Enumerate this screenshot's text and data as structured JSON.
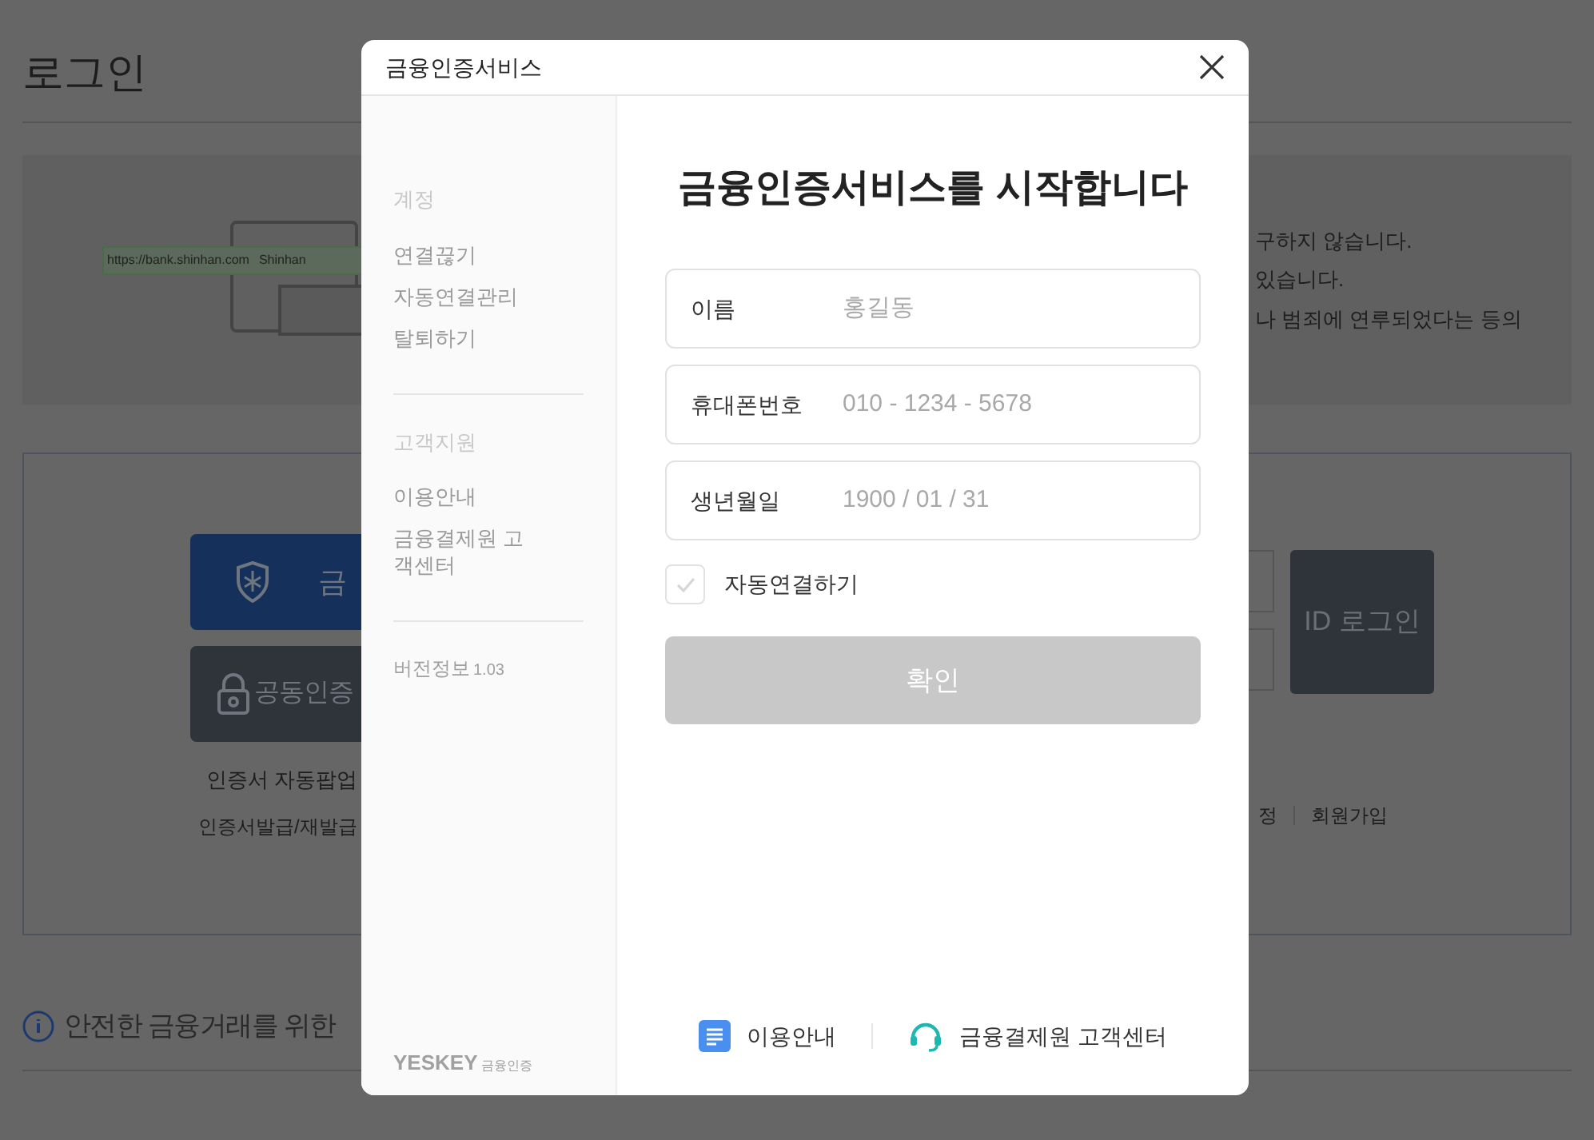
{
  "page": {
    "title": "로그인",
    "banner": {
      "url": "https://bank.shinhan.com",
      "site": "Shinhan",
      "notices": [
        "구하지 않습니다.",
        "있습니다.",
        "나 범죄에 연루되었다는 등의"
      ]
    },
    "login": {
      "buttons": [
        {
          "kind": "finance",
          "label": "금"
        },
        {
          "kind": "certificate",
          "label": "공동인증"
        }
      ],
      "links": [
        "인증서 자동팝업",
        "인증서발급/재발급"
      ],
      "id_login": "ID 로그인",
      "footer_links": [
        "정",
        "회원가입"
      ]
    },
    "safety_heading": "안전한 금융거래를 위한"
  },
  "dialog": {
    "title": "금융인증서비스",
    "sidebar": {
      "sections": [
        {
          "heading": "계정",
          "items": [
            "연결끊기",
            "자동연결관리",
            "탈퇴하기"
          ]
        },
        {
          "heading": "고객지원",
          "items": [
            "이용안내",
            "금융결제원 고객센터"
          ]
        }
      ],
      "version_label": "버전정보",
      "version": "1.03",
      "logo": "YESKEY",
      "logo_sub": "금융인증"
    },
    "heading": "금융인증서비스를 시작합니다",
    "fields": [
      {
        "label": "이름",
        "placeholder": "홍길동"
      },
      {
        "label": "휴대폰번호",
        "placeholder": "010 - 1234 - 5678"
      },
      {
        "label": "생년월일",
        "placeholder": "1900 / 01 / 31"
      }
    ],
    "auto_connect": {
      "label": "자동연결하기",
      "checked": false
    },
    "confirm": {
      "label": "확인",
      "disabled": true
    },
    "footer_links": [
      {
        "kind": "guide",
        "label": "이용안내"
      },
      {
        "kind": "support",
        "label": "금융결제원 고객센터"
      }
    ]
  }
}
